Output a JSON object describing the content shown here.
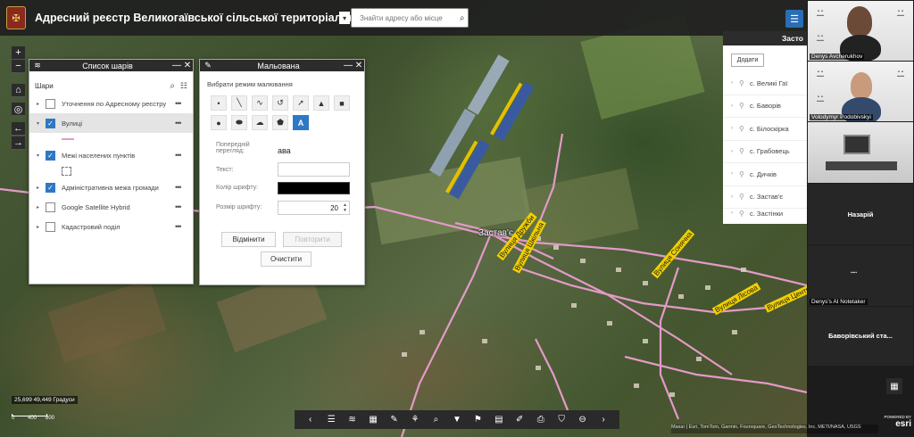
{
  "header": {
    "title": "Адресний реєстр Великогаївської сільської територіальної громади",
    "search_placeholder": "Знайти адресу або місце"
  },
  "map": {
    "zoom_in": "+",
    "zoom_out": "−",
    "place_label": "Застав'є",
    "road_labels": [
      "Вулиця Дружби",
      "Вулиця Шкільна",
      "Вулиця Сонячна",
      "Вулиця Лісова",
      "Вулиця Центральна"
    ],
    "coordinates": "25,699 49,449 Градуси",
    "scale_labels": [
      "0",
      "400",
      "800"
    ],
    "attribution": "Maxar | Esri, TomTom, Garmin, Foursquare, GeoTechnologies, Inc, METI/NASA, USGS",
    "esri_powered": "POWERED BY",
    "esri_brand": "esri"
  },
  "layers_panel": {
    "title": "Список шарів",
    "header": "Шари",
    "layers": [
      {
        "name": "Уточнення по Адресному реєстру",
        "checked": false
      },
      {
        "name": "Вулиці",
        "checked": true
      },
      {
        "name": "Межі населених пунктів",
        "checked": true
      },
      {
        "name": "Адміністративна межа громади",
        "checked": true
      },
      {
        "name": "Google Satellite Hybrid",
        "checked": false
      },
      {
        "name": "Кадастровий поділ",
        "checked": false
      }
    ],
    "more_icon": "•••"
  },
  "draw_panel": {
    "title": "Мальована",
    "mode_label": "Вибрати режим малювання",
    "tools": [
      "point-tool",
      "line-tool",
      "freehand-line-tool",
      "curve-tool",
      "arrow-tool",
      "triangle-tool",
      "rectangle-tool",
      "circle-tool",
      "ellipse-tool",
      "cloud-tool",
      "freehand-polygon-tool",
      "text-tool"
    ],
    "preview_label": "Попередній перегляд:",
    "preview_value": "ава",
    "text_label": "Текст:",
    "color_label": "Колір шрифту:",
    "size_label": "Розмір шрифту:",
    "size_value": "20",
    "cancel_label": "Відмінити",
    "undo_label": "Повторити",
    "clear_label": "Очистити",
    "text_tool_glyph": "A"
  },
  "settlements_panel": {
    "title": "Засто",
    "button_label": "Додати",
    "items": [
      "с. Великі Гаї",
      "с. Баворів",
      "с. Білоскірка",
      "с. Грабовець",
      "с. Дичків",
      "с. Застав'є",
      "с. Застінки"
    ]
  },
  "video": {
    "participants": [
      {
        "name": "Denys Avcherukhov"
      },
      {
        "name": "Volodymyr Podobivskyi"
      },
      {
        "name": ""
      },
      {
        "name": "Назарій"
      },
      {
        "name": "Denys's AI Notetaker"
      },
      {
        "name": "Баворівський ста..."
      }
    ]
  },
  "colors": {
    "accent": "#2f78c4",
    "header_bg": "#202020",
    "road_pink": "#e39ac8",
    "road_label_bg": "#f0d000"
  }
}
